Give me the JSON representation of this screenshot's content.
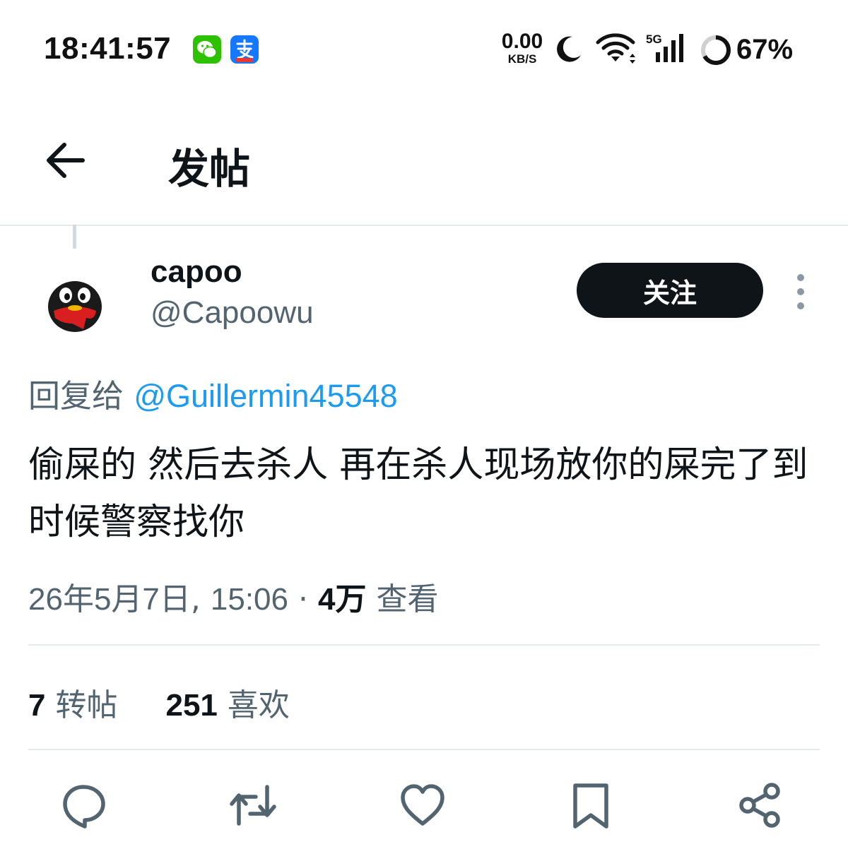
{
  "status_bar": {
    "time": "18:41:57",
    "net_speed_value": "0.00",
    "net_speed_unit": "KB/S",
    "network_type": "5G",
    "battery": "67%",
    "battery_level": 0.67,
    "notification_icons": [
      "wechat-icon",
      "alipay-icon"
    ],
    "status_icons": [
      "moon-icon",
      "wifi-icon",
      "cellular-signal-icon",
      "battery-ring-icon"
    ]
  },
  "header": {
    "title": "发帖",
    "back_icon": "arrow-left-icon"
  },
  "tweet": {
    "display_name": "capoo",
    "handle": "@Capoowu",
    "follow_label": "关注",
    "reply_prefix": "回复给",
    "reply_mention": "@Guillermin45548",
    "text": "偷屎的 然后去杀人 再在杀人现场放你的屎完了到时候警察找你",
    "date": "26年5月7日",
    "time": "15:06",
    "meta_separator": "·",
    "views_count": "4万",
    "views_label": "查看",
    "retweets_count": "7",
    "retweets_label": "转帖",
    "likes_count": "251",
    "likes_label": "喜欢"
  },
  "actions": [
    "reply-icon",
    "retweet-icon",
    "like-icon",
    "bookmark-icon",
    "share-icon"
  ],
  "colors": {
    "text_primary": "#0f1419",
    "text_secondary": "#536471",
    "link": "#1d9bf0",
    "divider": "#e6e9ec",
    "follow_bg": "#0f1419",
    "wechat": "#2dc100",
    "alipay": "#1677ff"
  }
}
